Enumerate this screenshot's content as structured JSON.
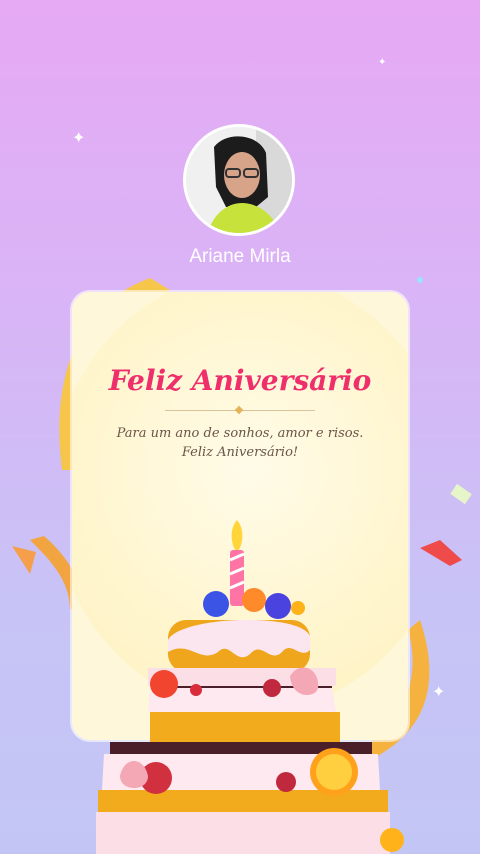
{
  "profile": {
    "name": "Ariane Mirla"
  },
  "card": {
    "title": "Feliz Aniversário",
    "message_line1": "Para um ano de sonhos, amor e risos.",
    "message_line2": "Feliz Aniversário!"
  },
  "colors": {
    "title": "#ee2f6b",
    "card_background": "#fff7d9",
    "ribbon": "#f7c342"
  }
}
